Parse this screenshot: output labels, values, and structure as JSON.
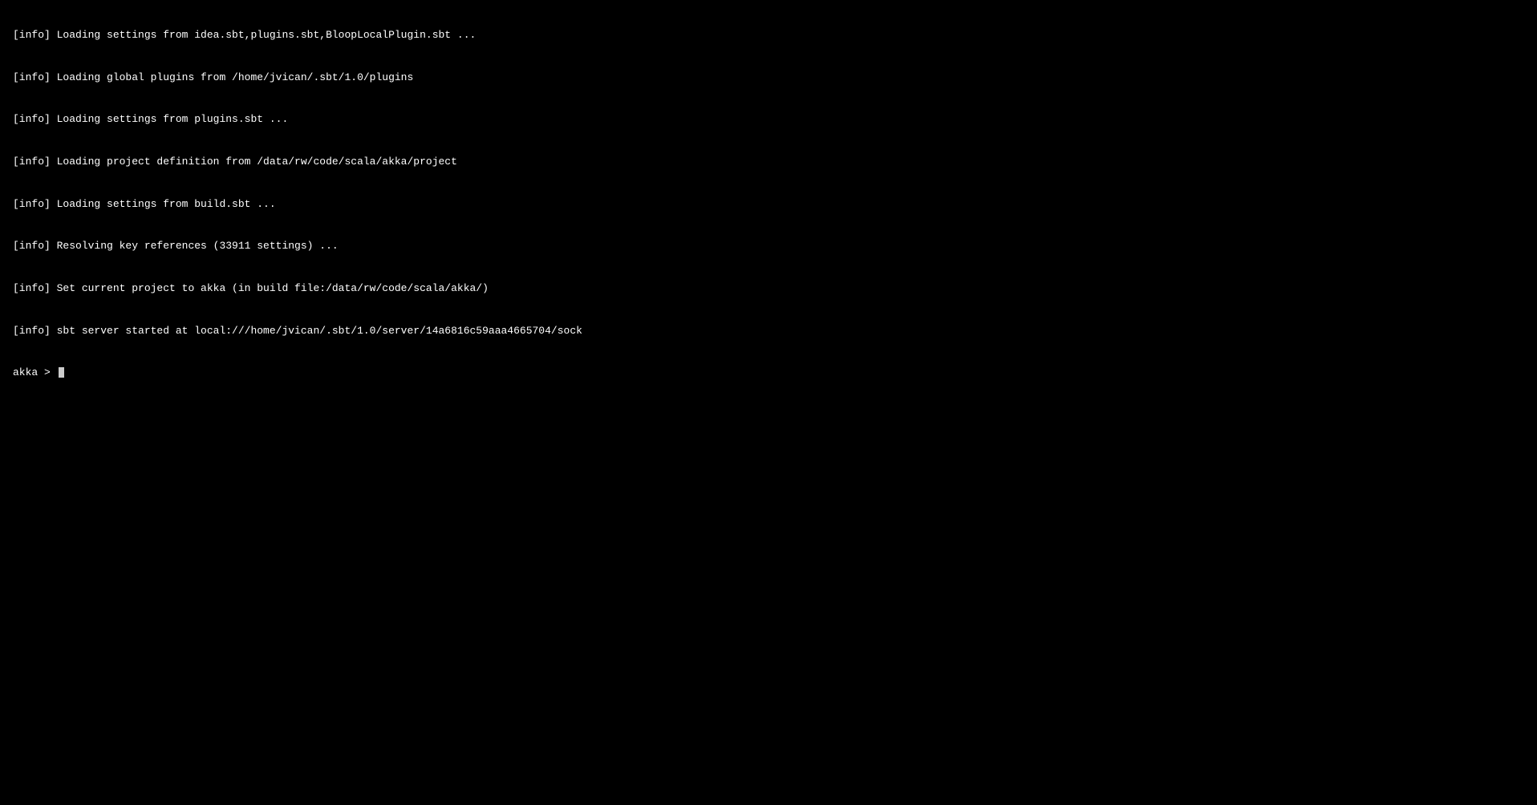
{
  "terminal": {
    "lines": [
      {
        "prefix": "[info]",
        "text": " Loading settings from idea.sbt,plugins.sbt,BloopLocalPlugin.sbt ..."
      },
      {
        "prefix": "[info]",
        "text": " Loading global plugins from /home/jvican/.sbt/1.0/plugins"
      },
      {
        "prefix": "[info]",
        "text": " Loading settings from plugins.sbt ..."
      },
      {
        "prefix": "[info]",
        "text": " Loading project definition from /data/rw/code/scala/akka/project"
      },
      {
        "prefix": "[info]",
        "text": " Loading settings from build.sbt ..."
      },
      {
        "prefix": "[info]",
        "text": " Resolving key references (33911 settings) ..."
      },
      {
        "prefix": "[info]",
        "text": " Set current project to akka (in build file:/data/rw/code/scala/akka/)"
      },
      {
        "prefix": "[info]",
        "text": " sbt server started at local:///home/jvican/.sbt/1.0/server/14a6816c59aaa4665704/sock"
      }
    ],
    "prompt": "akka > "
  }
}
